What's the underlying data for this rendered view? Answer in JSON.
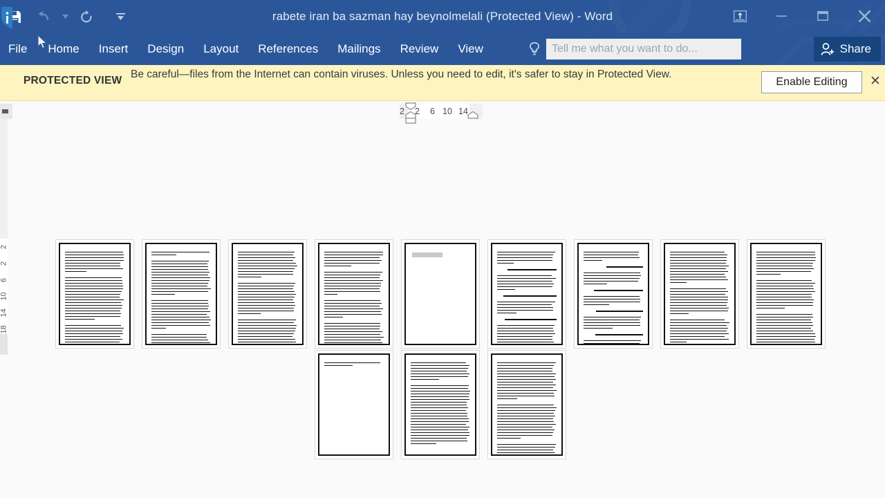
{
  "window": {
    "title": "rabete iran ba sazman hay beynolmelali (Protected View) - Word",
    "accent_color": "#2b579a",
    "share_button_color": "#19457f"
  },
  "quick_access": {
    "items": [
      {
        "name": "save-icon",
        "label": "Save",
        "state": "enabled"
      },
      {
        "name": "undo-icon",
        "label": "Undo",
        "state": "disabled"
      },
      {
        "name": "undo-dropdown-icon",
        "label": "Undo options",
        "state": "disabled"
      },
      {
        "name": "redo-icon",
        "label": "Redo",
        "state": "enabled"
      },
      {
        "name": "customize-qat-icon",
        "label": "Customize Quick Access Toolbar",
        "state": "enabled"
      }
    ]
  },
  "window_controls": {
    "ribbon_display_options": "Ribbon Display Options",
    "minimize": "Minimize",
    "restore": "Restore Down",
    "close": "Close"
  },
  "ribbon": {
    "tabs": [
      {
        "label": "File",
        "active": false
      },
      {
        "label": "Home",
        "active": false
      },
      {
        "label": "Insert",
        "active": false
      },
      {
        "label": "Design",
        "active": false
      },
      {
        "label": "Layout",
        "active": false
      },
      {
        "label": "References",
        "active": false
      },
      {
        "label": "Mailings",
        "active": false
      },
      {
        "label": "Review",
        "active": false
      },
      {
        "label": "View",
        "active": false
      }
    ],
    "tellme_placeholder": "Tell me what you want to do...",
    "tellme_value": "",
    "share_label": "Share"
  },
  "protected_view": {
    "badge": "PROTECTED VIEW",
    "message": "Be careful—files from the Internet can contain viruses. Unless you need to edit, it's safer to stay in Protected View.",
    "enable_button": "Enable Editing",
    "close_label": "✕",
    "bar_color": "#fdf4bf"
  },
  "horizontal_ruler": {
    "ticks": [
      {
        "label": "2",
        "x": 0
      },
      {
        "label": "2",
        "x": 22
      },
      {
        "label": "6",
        "x": 44
      },
      {
        "label": "10",
        "x": 62
      },
      {
        "label": "14",
        "x": 85
      }
    ]
  },
  "vertical_ruler": {
    "ticks": [
      "2",
      "2",
      "6",
      "10",
      "14",
      "18"
    ]
  },
  "document": {
    "view_mode": "Multiple Pages",
    "page_count": 12,
    "rows": [
      {
        "pages": [
          {
            "number": 1,
            "kind": "text",
            "paragraphs": [
              8,
              16,
              13
            ]
          },
          {
            "number": 2,
            "kind": "text",
            "paragraphs": [
              2,
              13,
              11,
              9
            ]
          },
          {
            "number": 3,
            "kind": "text",
            "paragraphs": [
              10,
              12,
              13
            ]
          },
          {
            "number": 4,
            "kind": "text",
            "paragraphs": [
              6,
              9,
              7,
              11,
              5
            ]
          },
          {
            "number": 5,
            "kind": "blank",
            "paragraphs": [],
            "selection_bar": true
          },
          {
            "number": 6,
            "kind": "text",
            "paragraphs": [
              5,
              1,
              6,
              1,
              5,
              1,
              9
            ]
          },
          {
            "number": 7,
            "kind": "text",
            "paragraphs": [
              4,
              1,
              5,
              1,
              4,
              1,
              5,
              1,
              4
            ]
          },
          {
            "number": 8,
            "kind": "text",
            "paragraphs": [
              12,
              10,
              9,
              6
            ]
          },
          {
            "number": 9,
            "kind": "text",
            "paragraphs": [
              9,
              11,
              12,
              4
            ]
          }
        ]
      },
      {
        "pages": [
          {
            "number": 10,
            "kind": "sparse",
            "paragraphs": [
              2
            ]
          },
          {
            "number": 11,
            "kind": "text",
            "paragraphs": [
              7,
              22
            ]
          },
          {
            "number": 12,
            "kind": "text",
            "paragraphs": [
              14,
              13,
              7
            ]
          }
        ]
      }
    ]
  }
}
